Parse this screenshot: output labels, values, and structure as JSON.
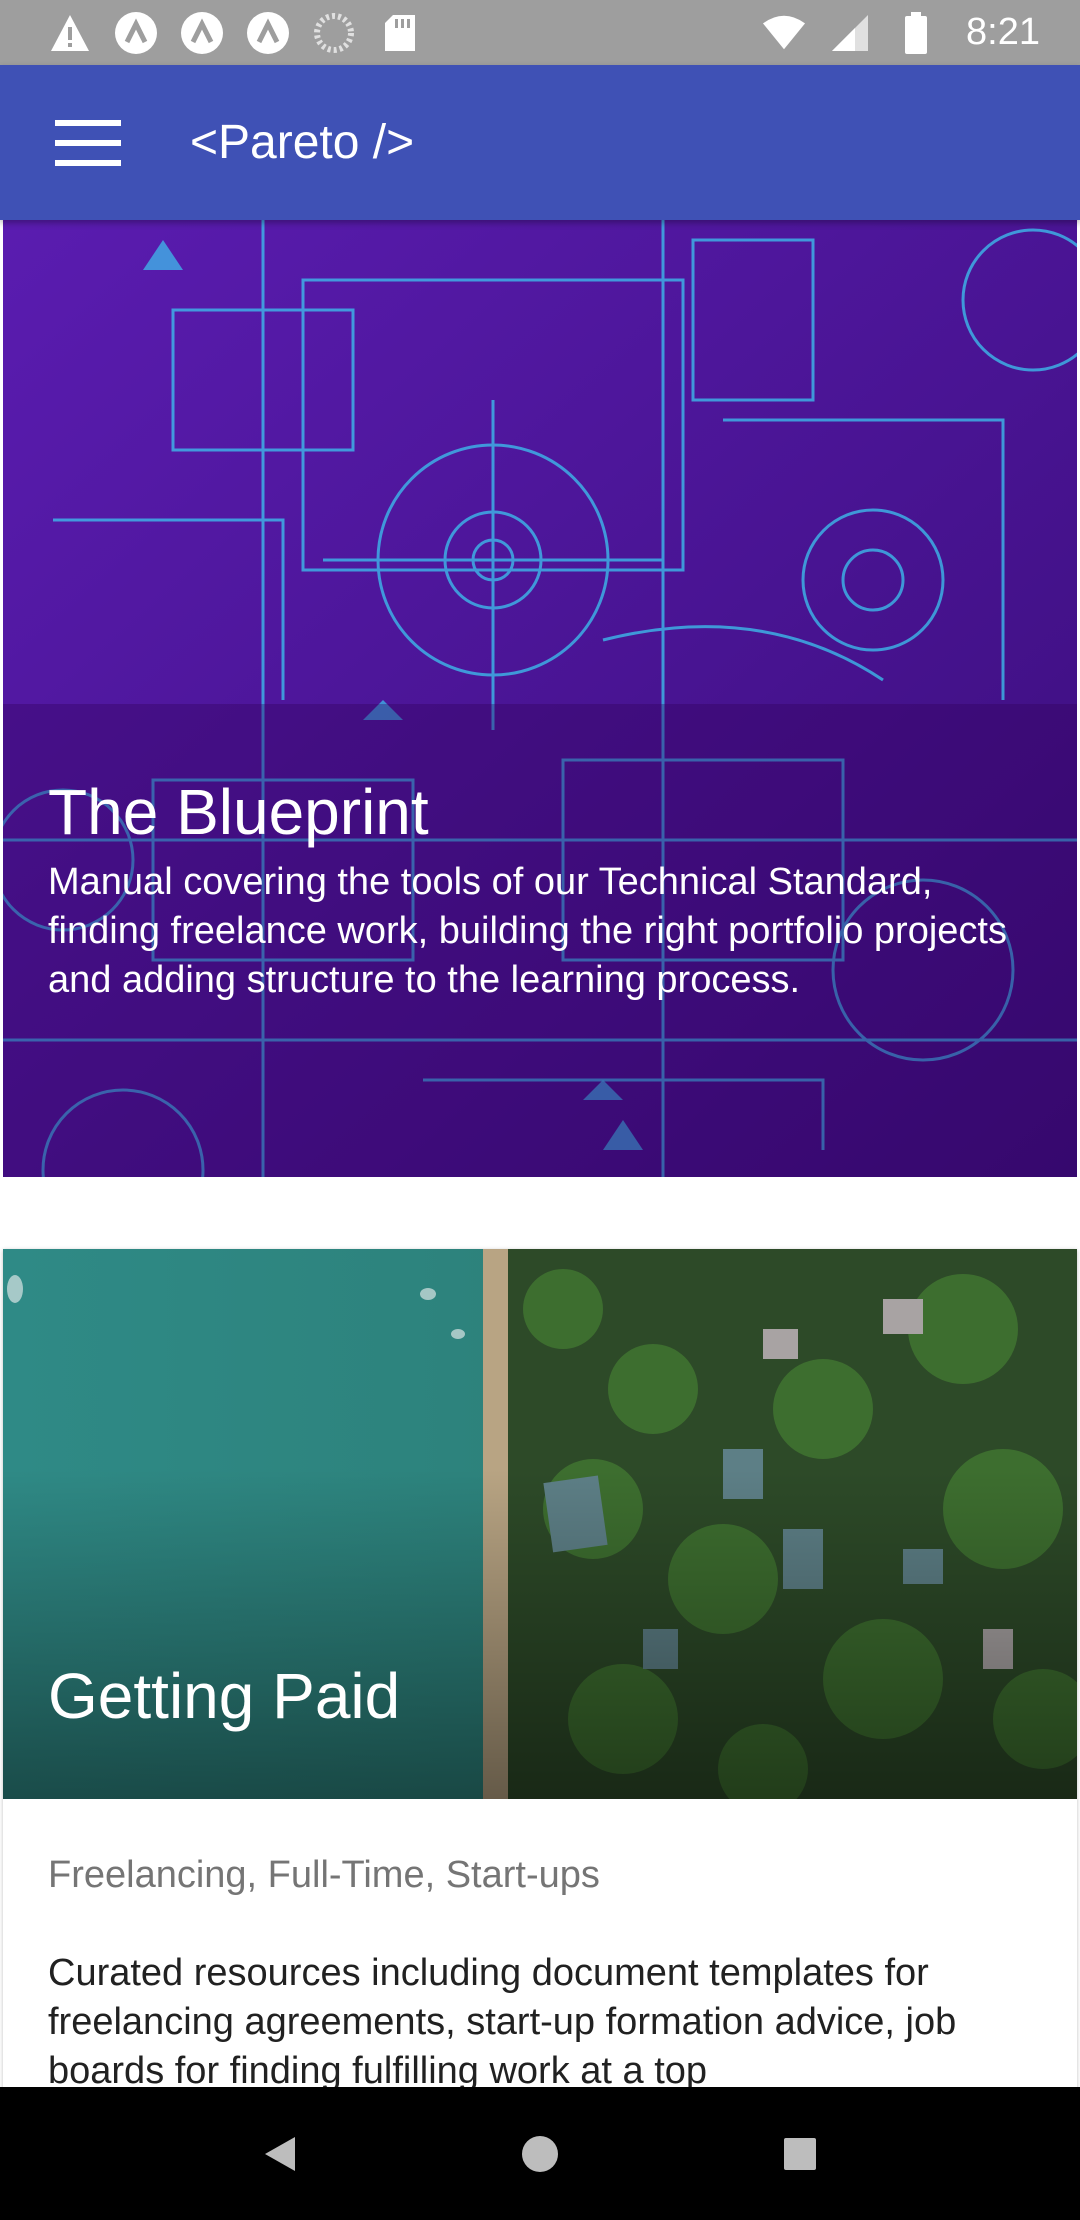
{
  "status_bar": {
    "time": "8:21",
    "left_icons": [
      "warning-icon",
      "app-a-icon",
      "app-a-icon",
      "app-a-icon",
      "loading-icon",
      "sd-card-icon"
    ],
    "right_icons": [
      "wifi-icon",
      "signal-icon",
      "battery-icon"
    ]
  },
  "app_bar": {
    "title": "<Pareto />",
    "background": "#3f51b5"
  },
  "cards": [
    {
      "title": "The Blueprint",
      "description": "Manual covering the tools of our Technical Standard, finding freelance work, building the right portfolio projects and adding structure to the learning process."
    },
    {
      "title": "Getting Paid",
      "subtitle": "Freelancing, Full-Time, Start-ups",
      "description": "Curated resources including document templates for freelancing agreements, start-up formation advice, job boards for finding fulfilling work at a top"
    }
  ],
  "nav_bar": {
    "buttons": [
      "back-icon",
      "home-icon",
      "recents-icon"
    ]
  }
}
